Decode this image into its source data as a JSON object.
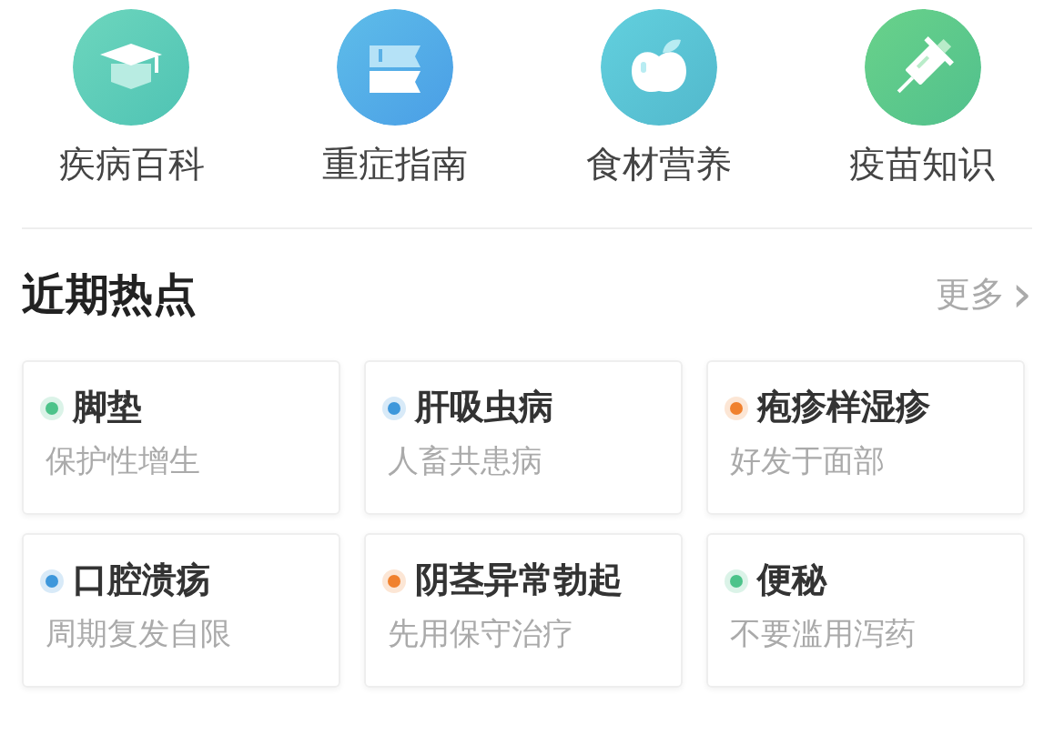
{
  "categories": [
    {
      "label": "疾病百科"
    },
    {
      "label": "重症指南"
    },
    {
      "label": "食材营养"
    },
    {
      "label": "疫苗知识"
    }
  ],
  "section": {
    "title": "近期热点",
    "more": "更多",
    "more_arrow": "›"
  },
  "topics": [
    {
      "title": "脚垫",
      "subtitle": "保护性增生",
      "color": "#4cc38a"
    },
    {
      "title": "肝吸虫病",
      "subtitle": "人畜共患病",
      "color": "#3d97db"
    },
    {
      "title": "疱疹样湿疹",
      "subtitle": "好发于面部",
      "color": "#f0812e"
    },
    {
      "title": "口腔溃疡",
      "subtitle": "周期复发自限",
      "color": "#3d97db"
    },
    {
      "title": "阴茎异常勃起",
      "subtitle": "先用保守治疗",
      "color": "#f0812e"
    },
    {
      "title": "便秘",
      "subtitle": "不要滥用泻药",
      "color": "#4cc38a"
    }
  ]
}
